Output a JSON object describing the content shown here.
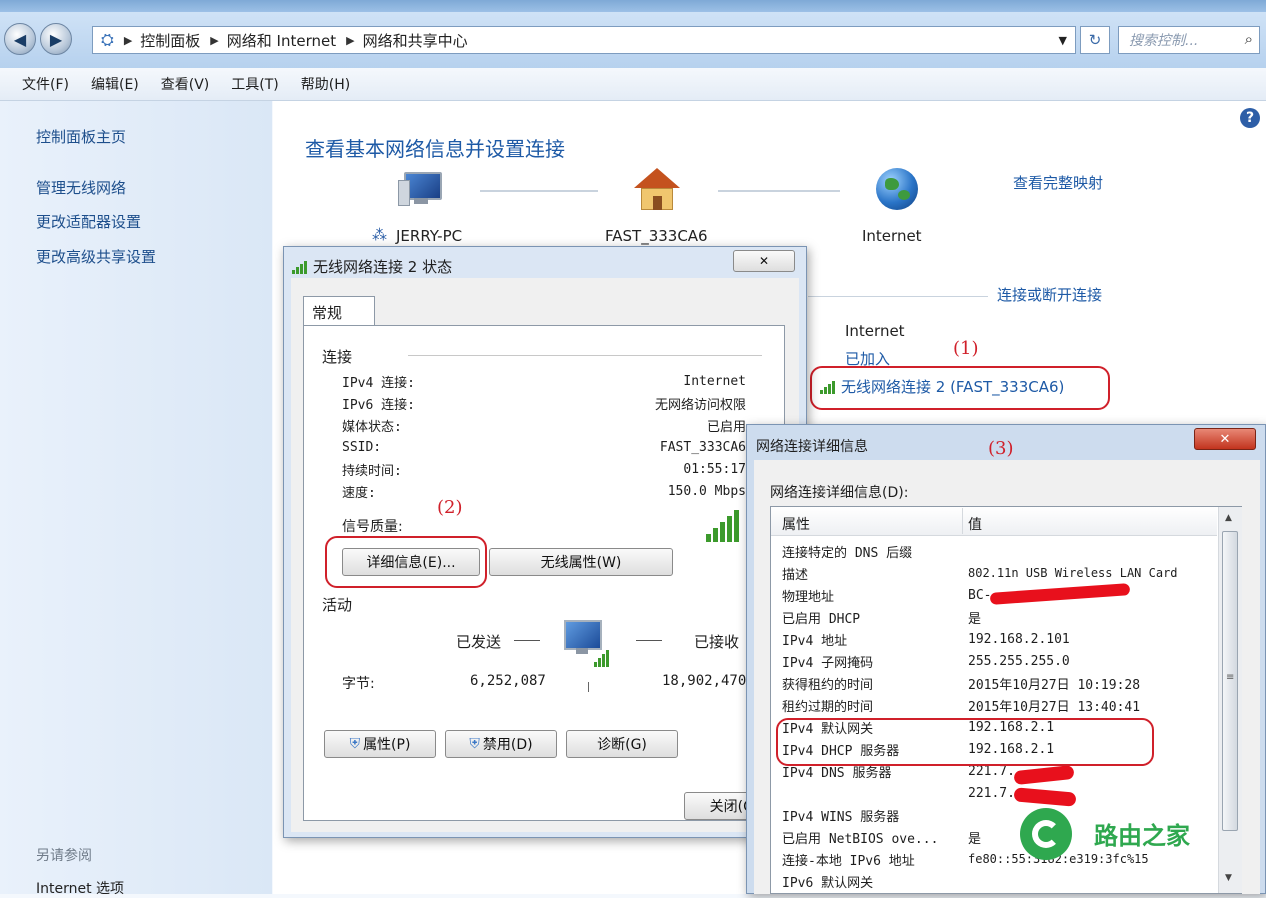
{
  "address_bar": {
    "crumbs": [
      "控制面板",
      "网络和 Internet",
      "网络和共享中心"
    ],
    "search_placeholder": "搜索控制...",
    "refresh_glyph": "↻"
  },
  "menu": [
    "文件(F)",
    "编辑(E)",
    "查看(V)",
    "工具(T)",
    "帮助(H)"
  ],
  "sidebar": {
    "items": [
      "控制面板主页",
      "管理无线网络",
      "更改适配器设置",
      "更改高级共享设置"
    ],
    "see_also": "另请参阅",
    "see_also_items": [
      "Internet 选项"
    ]
  },
  "main": {
    "title": "查看基本网络信息并设置连接",
    "view_full_map": "查看完整映射",
    "connect_disconnect": "连接或断开连接",
    "nodes": [
      "JERRY-PC",
      "FAST_333CA6",
      "Internet"
    ],
    "access_type": "Internet",
    "joined": "已加入",
    "wireless_link": "无线网络连接 2 (FAST_333CA6)",
    "help_glyph": "?"
  },
  "annotations": [
    "(1)",
    "(2)",
    "(3)"
  ],
  "status_dialog": {
    "title": "无线网络连接 2 状态",
    "close_glyph": "✕",
    "tab": "常规",
    "connection_heading": "连接",
    "rows": [
      {
        "label": "IPv4 连接:",
        "value": "Internet"
      },
      {
        "label": "IPv6 连接:",
        "value": "无网络访问权限"
      },
      {
        "label": "媒体状态:",
        "value": "已启用"
      },
      {
        "label": "SSID:",
        "value": "FAST_333CA6"
      },
      {
        "label": "持续时间:",
        "value": "01:55:17"
      },
      {
        "label": "速度:",
        "value": "150.0 Mbps"
      }
    ],
    "signal_label": "信号质量:",
    "details_button": "详细信息(E)...",
    "wireless_props_button": "无线属性(W)",
    "activity_heading": "活动",
    "sent_label": "已发送",
    "received_label": "已接收",
    "bytes_label": "字节:",
    "bytes_sent": "6,252,087",
    "bytes_received": "18,902,470",
    "properties_button": "属性(P)",
    "disable_button": "禁用(D)",
    "diagnose_button": "诊断(G)",
    "close_button": "关闭(C)"
  },
  "details_dialog": {
    "title": "网络连接详细信息",
    "close_glyph": "✕",
    "list_label": "网络连接详细信息(D):",
    "col_property": "属性",
    "col_value": "值",
    "rows": [
      {
        "property": "连接特定的 DNS 后缀",
        "value": ""
      },
      {
        "property": "描述",
        "value": "802.11n USB Wireless LAN Card"
      },
      {
        "property": "物理地址",
        "value": "BC-"
      },
      {
        "property": "已启用 DHCP",
        "value": "是"
      },
      {
        "property": "IPv4 地址",
        "value": "192.168.2.101"
      },
      {
        "property": "IPv4 子网掩码",
        "value": "255.255.255.0"
      },
      {
        "property": "获得租约的时间",
        "value": "2015年10月27日 10:19:28"
      },
      {
        "property": "租约过期的时间",
        "value": "2015年10月27日 13:40:41"
      },
      {
        "property": "IPv4 默认网关",
        "value": "192.168.2.1"
      },
      {
        "property": "IPv4 DHCP 服务器",
        "value": "192.168.2.1"
      },
      {
        "property": "IPv4 DNS 服务器",
        "value": "221.7."
      },
      {
        "property": "",
        "value": "221.7."
      },
      {
        "property": "IPv4 WINS 服务器",
        "value": ""
      },
      {
        "property": "已启用 NetBIOS ove...",
        "value": "是"
      },
      {
        "property": "连接-本地 IPv6 地址",
        "value": "fe80::55:3182:e319:3fc%15"
      },
      {
        "property": "IPv6 默认网关",
        "value": ""
      }
    ]
  },
  "watermark": {
    "text": "路由之家",
    "color": "#2fa84f"
  },
  "colors": {
    "link": "#1e5aa6",
    "annotation_red": "#d0202a"
  }
}
